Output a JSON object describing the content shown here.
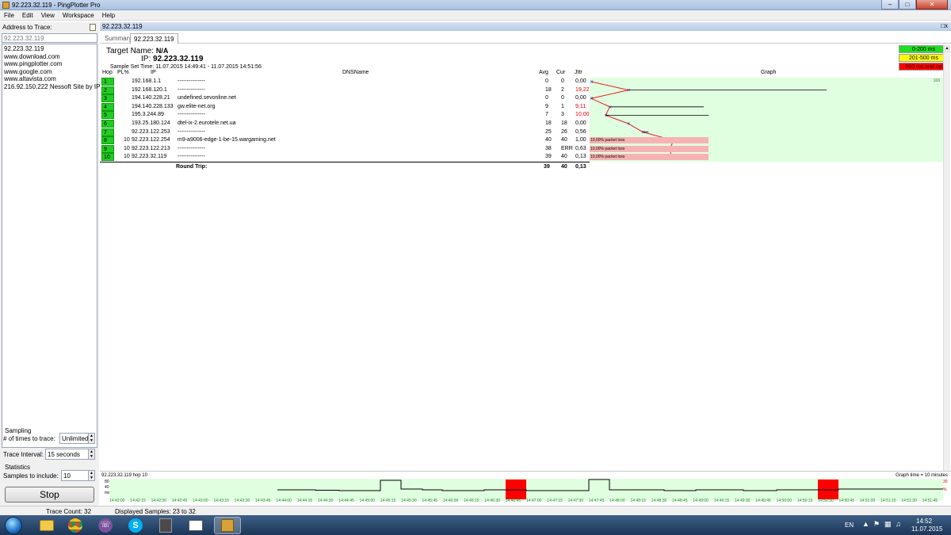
{
  "window": {
    "title": "92.223.32.119 - PingPlotter Pro"
  },
  "menu": [
    "File",
    "Edit",
    "View",
    "Workspace",
    "Help"
  ],
  "left": {
    "address_label": "Address to Trace:",
    "address_value": "92.223.32.119",
    "addresses": [
      "92.223.32.119",
      "www.download.com",
      "www.pingplotter.com",
      "www.google.com",
      "www.altavista.com",
      "216.92.150.222 Nessoft Site by IP"
    ],
    "sampling_title": "Sampling",
    "times_label": "# of times to trace:",
    "times_value": "Unlimited",
    "interval_label": "Trace Interval:",
    "interval_value": "15 seconds",
    "stats_title": "Statistics",
    "samples_label": "Samples to include:",
    "samples_value": "10",
    "stop_label": "Stop"
  },
  "pane": {
    "header": "92.223.32.119",
    "tab_summary": "Summary",
    "tab_active": "92.223.32.119"
  },
  "target": {
    "name_label": "Target Name:",
    "name_value": "N/A",
    "ip_label": "IP:",
    "ip_value": "92.223.32.119",
    "sst_label": "Sample Set Time:",
    "sst_value": "11.07.2015 14:49:41 - 11.07.2015 14:51:56"
  },
  "legend": [
    {
      "label": "0-200 ms",
      "color": "#22dd22"
    },
    {
      "label": "201-500 ms",
      "color": "#ffff00"
    },
    {
      "label": "500 ms and up",
      "color": "#ff0000"
    }
  ],
  "columns": {
    "hop": "Hop",
    "pl": "PL%",
    "ip": "IP",
    "dns": "DNSName",
    "avg": "Avg",
    "cur": "Cur",
    "jttr": "Jttr",
    "graph": "Graph"
  },
  "graph_max_label": "169",
  "hops": [
    {
      "hop": "1",
      "pl": "",
      "ip": "192.168.1.1",
      "dns": "---------------",
      "avg": "0",
      "cur": "0",
      "jttr": "0,00",
      "red": false,
      "loss": ""
    },
    {
      "hop": "2",
      "pl": "",
      "ip": "192.168.120.1",
      "dns": "---------------",
      "avg": "18",
      "cur": "2",
      "jttr": "19,22",
      "red": true,
      "loss": ""
    },
    {
      "hop": "3",
      "pl": "",
      "ip": "194.140.228.21",
      "dns": "undefined.sevonline.net",
      "avg": "0",
      "cur": "0",
      "jttr": "0,00",
      "red": false,
      "loss": ""
    },
    {
      "hop": "4",
      "pl": "",
      "ip": "194.140.228.133",
      "dns": "gw.elite-net.org",
      "avg": "9",
      "cur": "1",
      "jttr": "9,11",
      "red": true,
      "loss": ""
    },
    {
      "hop": "5",
      "pl": "",
      "ip": "195.3.244.89",
      "dns": "---------------",
      "avg": "7",
      "cur": "3",
      "jttr": "10,00",
      "red": true,
      "loss": ""
    },
    {
      "hop": "6",
      "pl": "",
      "ip": "193.25.180.124",
      "dns": "dtel-ix-2.eurotele.net.ua",
      "avg": "18",
      "cur": "18",
      "jttr": "0,00",
      "red": false,
      "loss": ""
    },
    {
      "hop": "7",
      "pl": "",
      "ip": "92.223.122.253",
      "dns": "---------------",
      "avg": "25",
      "cur": "26",
      "jttr": "0,56",
      "red": false,
      "loss": ""
    },
    {
      "hop": "8",
      "pl": "10",
      "ip": "92.223.122.254",
      "dns": "m9-a9006-edge-1-be-15.wargaming.net",
      "avg": "40",
      "cur": "40",
      "jttr": "1,00",
      "red": false,
      "loss": "10,00% packet loss"
    },
    {
      "hop": "9",
      "pl": "10",
      "ip": "92.223.122.213",
      "dns": "---------------",
      "avg": "38",
      "cur": "ERR",
      "jttr": "0,63",
      "red": false,
      "loss": "10,00% packet loss"
    },
    {
      "hop": "10",
      "pl": "10",
      "ip": "92.223.32.119",
      "dns": "---------------",
      "avg": "39",
      "cur": "40",
      "jttr": "0,13",
      "red": false,
      "loss": "10,00% packet loss"
    }
  ],
  "roundtrip": {
    "label": "Round Trip:",
    "avg": "39",
    "cur": "40",
    "jttr": "0,13"
  },
  "history": {
    "title": "92.223.32.119 hop 10",
    "graph_time": "Graph time = 10 minutes",
    "y_ticks": [
      "80",
      "40",
      "ms"
    ],
    "right_ticks": [
      "30",
      "%"
    ],
    "times": [
      "14:42:00",
      "14:42:15",
      "14:42:30",
      "14:42:45",
      "14:43:00",
      "14:43:15",
      "14:43:30",
      "14:43:45",
      "14:44:00",
      "14:44:15",
      "14:44:30",
      "14:44:45",
      "14:45:00",
      "14:45:15",
      "14:45:30",
      "14:45:45",
      "14:46:00",
      "14:46:15",
      "14:46:30",
      "14:46:45",
      "14:47:00",
      "14:47:15",
      "14:47:30",
      "14:47:45",
      "14:48:00",
      "14:48:15",
      "14:48:30",
      "14:48:45",
      "14:49:00",
      "14:49:15",
      "14:49:30",
      "14:49:45",
      "14:50:00",
      "14:50:15",
      "14:50:30",
      "14:50:45",
      "14:51:00",
      "14:51:15",
      "14:51:30",
      "14:51:45"
    ]
  },
  "status": {
    "trace_count": "Trace Count: 32",
    "displayed": "Displayed Samples: 23 to 32"
  },
  "tray": {
    "lang": "EN",
    "time": "14:52",
    "date": "11.07.2015"
  }
}
